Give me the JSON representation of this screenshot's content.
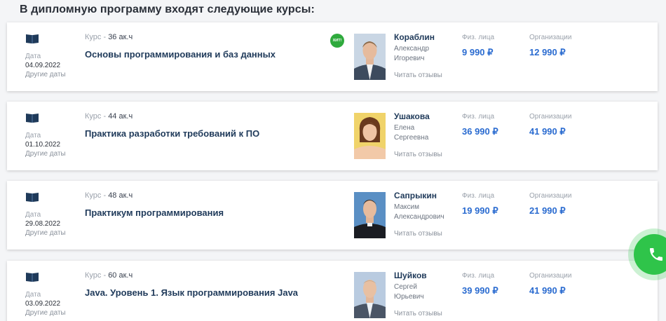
{
  "heading": "В дипломную программу входят следующие курсы:",
  "colors": {
    "accent": "#2a6bd0",
    "title": "#1f3a5a",
    "badge": "#2faa3d",
    "call": "#2fc44a"
  },
  "labels": {
    "date": "Дата",
    "other_dates": "Другие даты",
    "course_prefix": "Курс - ",
    "read_reviews": "Читать отзывы",
    "fiz": "Физ. лица",
    "org": "Организации",
    "hit_badge": "ХИТ!"
  },
  "courses": [
    {
      "hours": "36 ак.ч",
      "title": "Основы программирования и баз данных",
      "date": "04.09.2022",
      "hit": true,
      "teacher": {
        "surname": "Кораблин",
        "name": "Александр",
        "patronymic": "Игоревич"
      },
      "price_fiz": "9 990 ₽",
      "price_org": "12 990 ₽"
    },
    {
      "hours": "44 ак.ч",
      "title": "Практика разработки требований к ПО",
      "date": "01.10.2022",
      "hit": false,
      "teacher": {
        "surname": "Ушакова",
        "name": "Елена",
        "patronymic": "Сергеевна"
      },
      "price_fiz": "36 990 ₽",
      "price_org": "41 990 ₽"
    },
    {
      "hours": "48 ак.ч",
      "title": "Практикум программирования",
      "date": "29.08.2022",
      "hit": false,
      "teacher": {
        "surname": "Сапрыкин",
        "name": "Максим",
        "patronymic": "Александрович"
      },
      "price_fiz": "19 990 ₽",
      "price_org": "21 990 ₽"
    },
    {
      "hours": "60 ак.ч",
      "title": "Java. Уровень 1. Язык программирования Java",
      "date": "03.09.2022",
      "hit": false,
      "teacher": {
        "surname": "Шуйков",
        "name": "Сергей",
        "patronymic": "Юрьевич"
      },
      "price_fiz": "39 990 ₽",
      "price_org": "41 990 ₽"
    }
  ]
}
